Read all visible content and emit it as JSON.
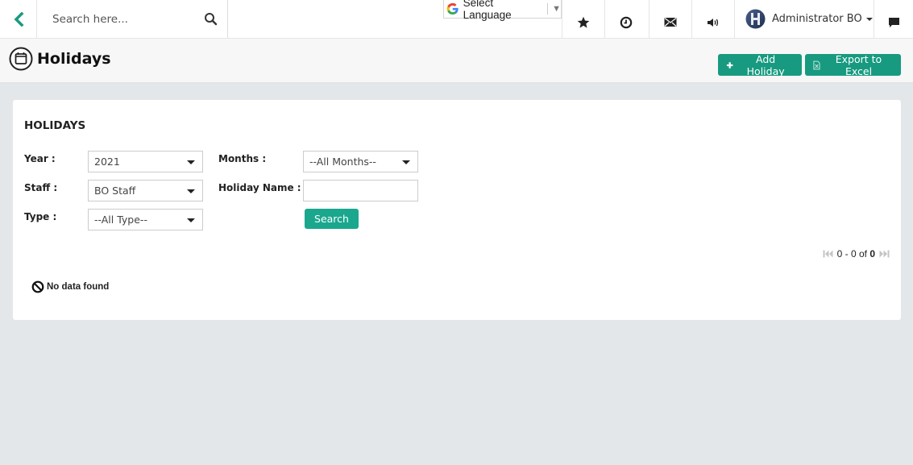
{
  "topbar": {
    "search_placeholder": "Search here...",
    "language_label": "Select Language",
    "icons": [
      "favorites-star-icon",
      "history-clock-icon",
      "mail-envelope-icon",
      "announcement-speaker-icon",
      "chat-icon"
    ],
    "user_name": "Administrator BO"
  },
  "page": {
    "title": "Holidays",
    "add_button": "Add Holiday",
    "export_button": "Export to Excel"
  },
  "card": {
    "title": "HOLIDAYS",
    "filters": {
      "year_label": "Year :",
      "year_value": "2021",
      "staff_label": "Staff :",
      "staff_value": "BO Staff",
      "type_label": "Type :",
      "type_value": "--All Type--",
      "months_label": "Months :",
      "months_value": "--All Months--",
      "holiday_name_label": "Holiday Name :",
      "holiday_name_value": "",
      "search_button": "Search"
    },
    "pagination": {
      "range": "0 - 0 of",
      "total": "0"
    },
    "empty_message": "No data found"
  },
  "colors": {
    "accent": "#179a80",
    "back_arrow": "#1a9a80"
  }
}
